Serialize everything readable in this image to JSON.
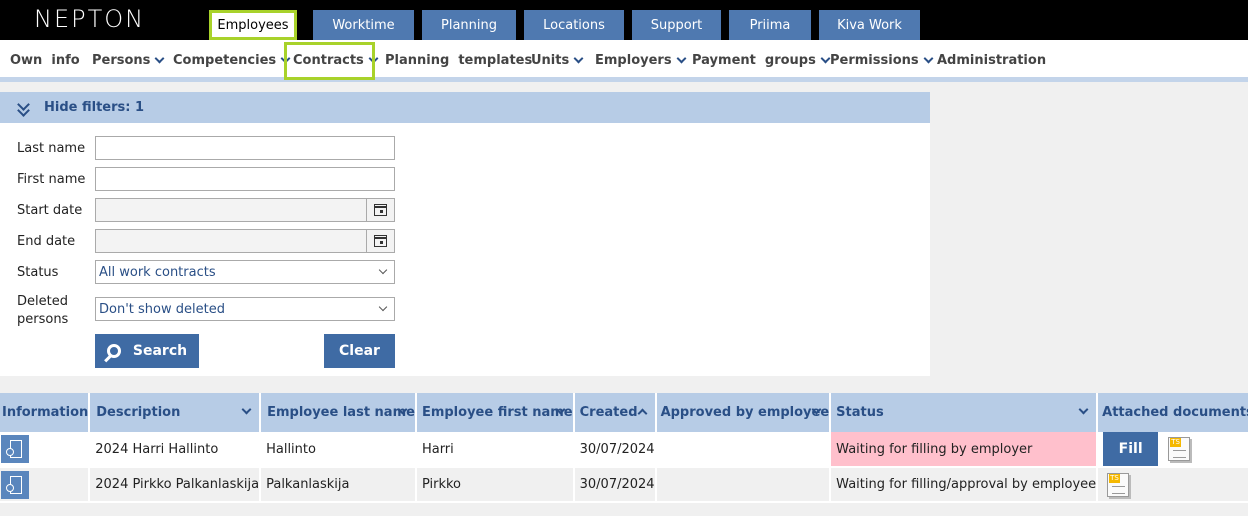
{
  "app": {
    "logo": "NEPTON"
  },
  "tabs": [
    {
      "label": "Employees",
      "active": true
    },
    {
      "label": "Worktime"
    },
    {
      "label": "Planning"
    },
    {
      "label": "Locations"
    },
    {
      "label": "Support"
    },
    {
      "label": "Priima"
    },
    {
      "label": "Kiva Work"
    }
  ],
  "subnav": [
    {
      "label": "Own  info"
    },
    {
      "label": "Persons",
      "dropdown": true
    },
    {
      "label": "Competencies",
      "dropdown": true
    },
    {
      "label": "Contracts",
      "dropdown": true,
      "active": true
    },
    {
      "label": "Planning  templates"
    },
    {
      "label": "Units",
      "dropdown": true
    },
    {
      "label": "Employers",
      "dropdown": true
    },
    {
      "label": "Payment  groups",
      "dropdown": true
    },
    {
      "label": "Permissions",
      "dropdown": true
    },
    {
      "label": "Administration"
    }
  ],
  "filters": {
    "toggle_label": "Hide filters: 1",
    "last_name_label": "Last name",
    "last_name_value": "",
    "first_name_label": "First name",
    "first_name_value": "",
    "start_date_label": "Start date",
    "start_date_value": "",
    "end_date_label": "End date",
    "end_date_value": "",
    "status_label": "Status",
    "status_value": "All work contracts",
    "deleted_label": "Deleted persons",
    "deleted_value": "Don't show deleted",
    "search_label": "Search",
    "clear_label": "Clear"
  },
  "table": {
    "headers": [
      "Information",
      "Description",
      "Employee last name",
      "Employee first name",
      "Created",
      "Approved by employee",
      "Status",
      "Attached documents"
    ],
    "rows": [
      {
        "description": "2024 Harri Hallinto",
        "last_name": "Hallinto",
        "first_name": "Harri",
        "created": "30/07/2024",
        "approved": "",
        "status": "Waiting for filling by employer",
        "fill_label": "Fill"
      },
      {
        "description": "2024 Pirkko Palkanlaskija",
        "last_name": "Palkanlaskija",
        "first_name": "Pirkko",
        "created": "30/07/2024",
        "approved": "",
        "status": "Waiting for filling/approval by employee"
      }
    ]
  },
  "colors": {
    "accent": "#3f6ba4",
    "header_bg": "#b7cce6",
    "highlight": "#a8d22a",
    "status_warn": "#ffc0cc"
  }
}
